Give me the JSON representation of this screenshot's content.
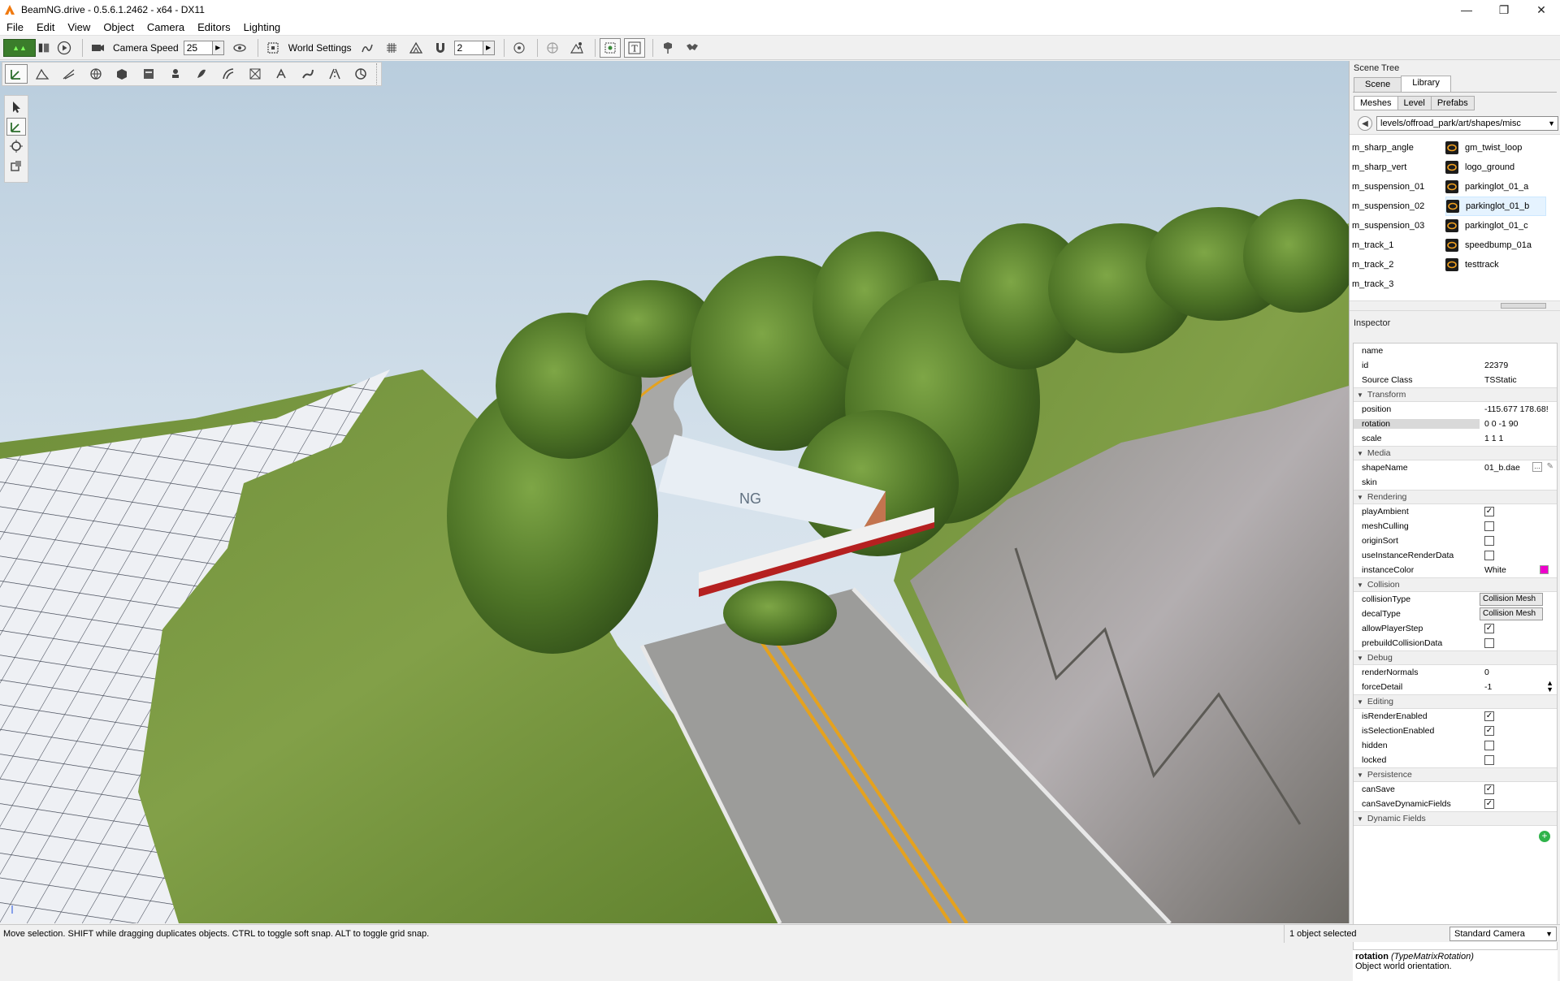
{
  "window": {
    "title": "BeamNG.drive - 0.5.6.1.2462 - x64 - DX11",
    "minimize": "—",
    "maximize": "❐",
    "close": "✕"
  },
  "menu": [
    "File",
    "Edit",
    "View",
    "Object",
    "Camera",
    "Editors",
    "Lighting"
  ],
  "toolbar": {
    "camera_speed_label": "Camera Speed",
    "camera_speed_value": "25",
    "world_settings_label": "World Settings",
    "snap_value": "2"
  },
  "scene_tree": {
    "title": "Scene Tree",
    "tabs": [
      "Scene",
      "Library"
    ],
    "active_tab": "Library",
    "subtabs": [
      "Meshes",
      "Level",
      "Prefabs"
    ],
    "path": "levels/offroad_park/art/shapes/misc",
    "left_items": [
      "m_sharp_angle",
      "m_sharp_vert",
      "m_suspension_01",
      "m_suspension_02",
      "m_suspension_03",
      "m_track_1",
      "m_track_2",
      "m_track_3"
    ],
    "right_items": [
      "gm_twist_loop",
      "logo_ground",
      "parkinglot_01_a",
      "parkinglot_01_b",
      "parkinglot_01_c",
      "speedbump_01a",
      "testtrack"
    ],
    "selected_item": "parkinglot_01_b"
  },
  "inspector": {
    "title": "Inspector",
    "general": [
      {
        "name": "name",
        "value": ""
      },
      {
        "name": "id",
        "value": "22379"
      },
      {
        "name": "Source Class",
        "value": "TSStatic"
      }
    ],
    "transform_label": "Transform",
    "transform": [
      {
        "name": "position",
        "value": "-115.677 178.68!"
      },
      {
        "name": "rotation",
        "value": "0 0 -1 90"
      },
      {
        "name": "scale",
        "value": "1 1 1"
      }
    ],
    "media_label": "Media",
    "media": [
      {
        "name": "shapeName",
        "value": "01_b.dae"
      },
      {
        "name": "skin",
        "value": ""
      }
    ],
    "rendering_label": "Rendering",
    "rendering": [
      {
        "name": "playAmbient",
        "checked": true
      },
      {
        "name": "meshCulling",
        "checked": false
      },
      {
        "name": "originSort",
        "checked": false
      },
      {
        "name": "useInstanceRenderData",
        "checked": false
      }
    ],
    "instance_color": {
      "name": "instanceColor",
      "value": "White",
      "swatch": "#ee00cc"
    },
    "collision_label": "Collision",
    "collision_dd": [
      {
        "name": "collisionType",
        "value": "Collision Mesh"
      },
      {
        "name": "decalType",
        "value": "Collision Mesh"
      }
    ],
    "collision_chk": [
      {
        "name": "allowPlayerStep",
        "checked": true
      },
      {
        "name": "prebuildCollisionData",
        "checked": false
      }
    ],
    "debug_label": "Debug",
    "debug": [
      {
        "name": "renderNormals",
        "value": "0"
      },
      {
        "name": "forceDetail",
        "value": "-1"
      }
    ],
    "editing_label": "Editing",
    "editing": [
      {
        "name": "isRenderEnabled",
        "checked": true
      },
      {
        "name": "isSelectionEnabled",
        "checked": true
      },
      {
        "name": "hidden",
        "checked": false
      },
      {
        "name": "locked",
        "checked": false
      }
    ],
    "persistence_label": "Persistence",
    "persistence": [
      {
        "name": "canSave",
        "checked": true
      },
      {
        "name": "canSaveDynamicFields",
        "checked": true
      }
    ],
    "dynamic_label": "Dynamic Fields",
    "help_field": "rotation",
    "help_type": "(TypeMatrixRotation)",
    "help_desc": "Object world orientation."
  },
  "viewport": {
    "container_text": "NG"
  },
  "status": {
    "message": "Move selection.  SHIFT while dragging duplicates objects.  CTRL to toggle soft snap.  ALT to toggle grid snap.",
    "selection": "1 object selected",
    "camera": "Standard Camera"
  }
}
